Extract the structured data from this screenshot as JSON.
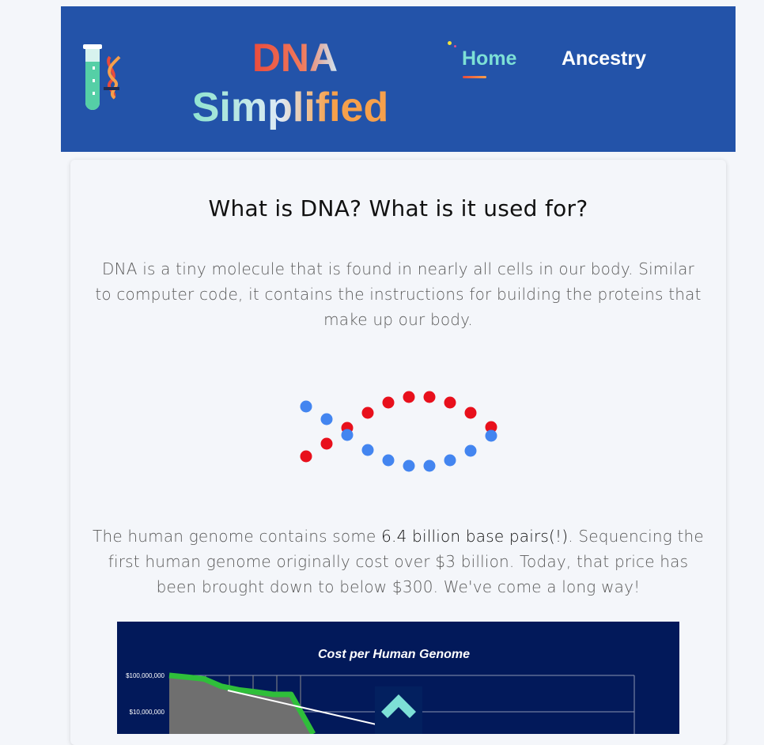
{
  "brand": {
    "line1": "DNA",
    "line2": "Simplified",
    "icon": "test-tube-dna-icon"
  },
  "nav": [
    {
      "label": "Home",
      "active": true
    },
    {
      "label": "Ancestry",
      "active": false
    }
  ],
  "article": {
    "heading": "What is DNA? What is it used for?",
    "intro": "DNA is a tiny molecule that is found in nearly all cells in our body. Similar to computer code, it contains the instructions for building the proteins that make up our body.",
    "genome_pre": "The human genome contains some ",
    "genome_highlight": "6.4 billion base pairs(!)",
    "genome_post": ". Sequencing the first human genome originally cost over $3 billion. Today, that price has been brought down to below $300. We've come a long way!"
  },
  "colors": {
    "header_bg": "#2353a9",
    "nav_active": "#7de0d6",
    "dot_red": "#e8101c",
    "dot_blue": "#4385f0",
    "chart_bg": "#02195a"
  },
  "chart_data": {
    "type": "line",
    "title": "Cost per Human Genome",
    "y_scale": "log",
    "y_ticks": [
      "$100,000,000",
      "$10,000,000"
    ],
    "series": [
      {
        "values": [
          100000000,
          90000000,
          80000000,
          50000000,
          40000000,
          35000000,
          30000000,
          30000000,
          8000000
        ]
      }
    ]
  }
}
